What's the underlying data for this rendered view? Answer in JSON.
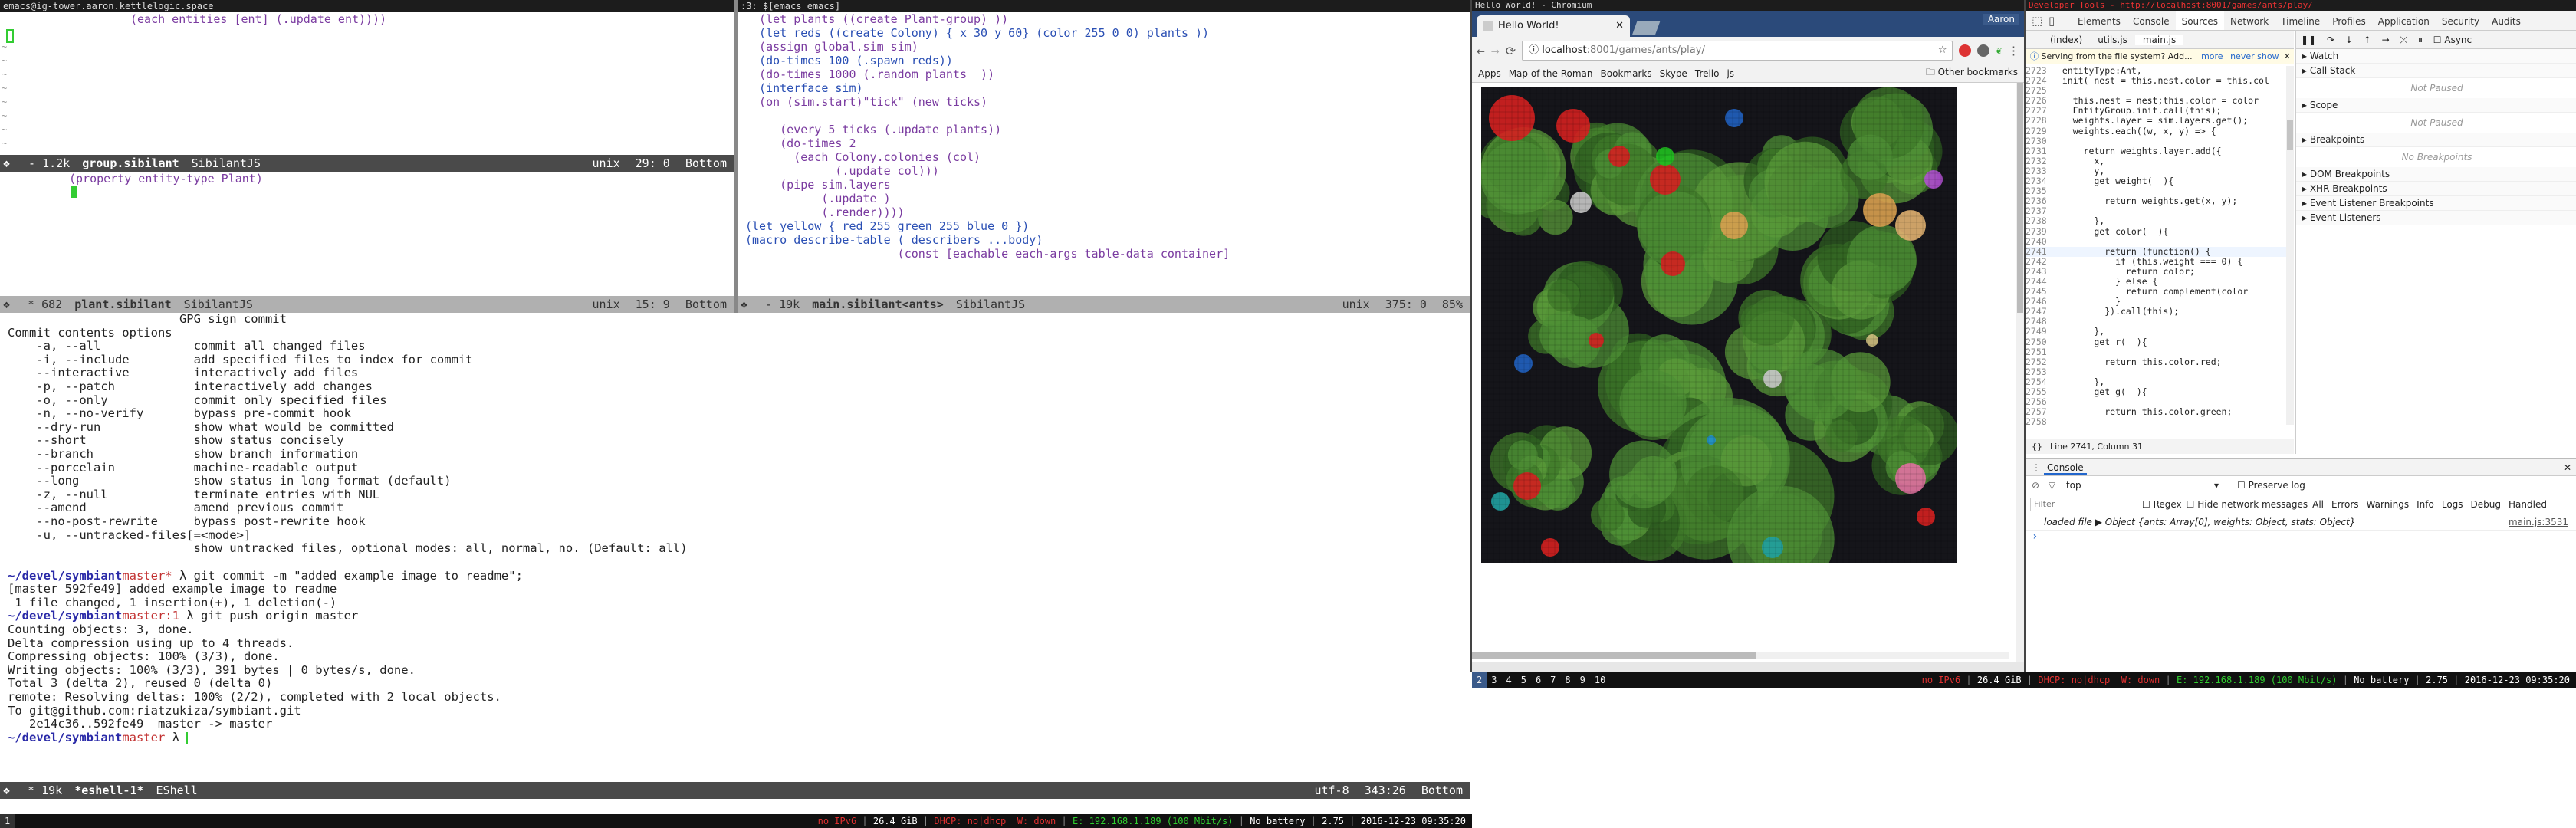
{
  "emacs": {
    "title": "emacs@ig-tower.aaron.kettlelogic.space",
    "top_pane_line": "(each entities [ent] (.update ent))))",
    "modeline1": {
      "status": " - 1.2k",
      "buffer": "group.sibilant",
      "mode": "SibilantJS",
      "enc": "unix",
      "pos": "29: 0",
      "scroll": "Bottom"
    },
    "middle_pane": [
      "(property entity-type Plant)"
    ],
    "modeline2": {
      "status": " * 682",
      "buffer": "plant.sibilant",
      "mode": "SibilantJS",
      "enc": "unix",
      "pos": "15: 9",
      "scroll": "Bottom"
    },
    "commit_help": [
      "                        GPG sign commit",
      "",
      "Commit contents options",
      "    -a, --all             commit all changed files",
      "    -i, --include         add specified files to index for commit",
      "    --interactive         interactively add files",
      "    -p, --patch           interactively add changes",
      "    -o, --only            commit only specified files",
      "    -n, --no-verify       bypass pre-commit hook",
      "    --dry-run             show what would be committed",
      "    --short               show status concisely",
      "    --branch              show branch information",
      "    --porcelain           machine-readable output",
      "    --long                show status in long format (default)",
      "    -z, --null            terminate entries with NUL",
      "    --amend               amend previous commit",
      "    --no-post-rewrite     bypass post-rewrite hook",
      "    -u, --untracked-files[=<mode>]",
      "                          show untracked files, optional modes: all, normal, no. (Default: all)"
    ],
    "prompt_path": "~/devel/symbiant",
    "prompt_branch": "master*",
    "prompt_branch2": "master:1",
    "prompt_branch3": "master",
    "cmd1": " λ git commit -m \"added example image to readme\";",
    "cmd2": " λ git push origin master",
    "output1": [
      "[master 592fe49] added example image to readme",
      " 1 file changed, 1 insertion(+), 1 deletion(-)"
    ],
    "output2": [
      "Counting objects: 3, done.",
      "Delta compression using up to 4 threads.",
      "Compressing objects: 100% (3/3), done.",
      "Writing objects: 100% (3/3), 391 bytes | 0 bytes/s, done.",
      "Total 3 (delta 2), reused 0 (delta 0)",
      "remote: Resolving deltas: 100% (2/2), completed with 2 local objects.",
      "To git@github.com:riatzukiza/symbiant.git",
      "   2e14c36..592fe49  master -> master"
    ],
    "cmd3": " λ ",
    "modeline3": {
      "status": " * 19k",
      "buffer": "*eshell-1*",
      "mode": "EShell",
      "enc": "utf-8",
      "pos": "343:26",
      "scroll": "Bottom"
    },
    "right_title": ":3: $[emacs emacs]",
    "right_modeline": {
      "status": " - 19k",
      "buffer": "main.sibilant<ants>",
      "mode": "SibilantJS",
      "enc": "unix",
      "pos": "375: 0",
      "scroll": "85%"
    }
  },
  "code": {
    "lines": [
      [
        "  ",
        "(let plants ((create Plant-group) ))"
      ],
      [
        "  ",
        "(let reds ((create Colony) { x 30 y 60} (color 255 0 0) plants ))"
      ],
      [
        "  ",
        "(assign global.sim sim)"
      ],
      [
        "  ",
        "(do-times 100 (.spawn reds))"
      ],
      [
        "  ",
        "(do-times 1000 (.random plants  ))"
      ],
      [
        "  ",
        "(interface sim)"
      ],
      [
        "  ",
        "(on (sim.start)\"tick\" (new ticks)"
      ],
      [
        "  ",
        ""
      ],
      [
        "  ",
        "   (every 5 ticks (.update plants))"
      ],
      [
        "  ",
        "   (do-times 2"
      ],
      [
        "  ",
        "     (each Colony.colonies (col)"
      ],
      [
        "  ",
        "           (.update col)))"
      ],
      [
        "  ",
        "   (pipe sim.layers"
      ],
      [
        "  ",
        "         (.update )"
      ],
      [
        "  ",
        "         (.render))))"
      ],
      [
        "",
        "(let yellow { red 255 green 255 blue 0 })"
      ],
      [
        "",
        ""
      ],
      [
        "",
        ""
      ],
      [
        "",
        "(macro describe-table ( describers ...body)"
      ],
      [
        "",
        "                      (const [eachable each-args table-data container]"
      ]
    ]
  },
  "chromium": {
    "window_title": "Hello World! - Chromium",
    "user": "Aaron",
    "tab_title": "Hello World!",
    "url_host": "localhost",
    "url_rest": ":8001/games/ants/play/",
    "bookmarks": [
      "Apps",
      "Map of the Roman",
      "Bookmarks",
      "Skype",
      "Trello",
      "js"
    ],
    "other_bookmarks": "Other bookmarks"
  },
  "devtools": {
    "title": "Developer Tools - http://localhost:8001/games/ants/play/",
    "tabs": [
      "Elements",
      "Console",
      "Sources",
      "Network",
      "Timeline",
      "Profiles",
      "Application",
      "Security",
      "Audits"
    ],
    "active_tab": "Sources",
    "file_tabs": [
      "(index)",
      "utils.js",
      "main.js"
    ],
    "notice": "Serving from the file system? Add...",
    "notice_more": "more",
    "notice_never": "never show",
    "code_start": 2723,
    "code": [
      "  entityType:Ant,",
      "  init( nest = this.nest.color = this.col",
      "",
      "    this.nest = nest;this.color = color",
      "    EntityGroup.init.call(this);",
      "    weights.layer = sim.layers.get();",
      "    weights.each((w, x, y) => {",
      "",
      "      return weights.layer.add({",
      "        x,",
      "        y,",
      "        get weight(  ){",
      "",
      "          return weights.get(x, y);",
      "",
      "        },",
      "        get color(  ){",
      "",
      "          return (function() {",
      "            if (this.weight === 0) {",
      "              return color;",
      "            } else {",
      "              return complement(color",
      "            }",
      "          }).call(this);",
      "",
      "        },",
      "        get r(  ){",
      "",
      "          return this.color.red;",
      "",
      "        },",
      "        get g(  ){",
      "",
      "          return this.color.green;",
      ""
    ],
    "cursor": "Line 2741, Column 31",
    "async": "Async",
    "sidebar": [
      {
        "head": "Watch",
        "info": ""
      },
      {
        "head": "Call Stack",
        "info": "Not Paused"
      },
      {
        "head": "Scope",
        "info": "Not Paused"
      },
      {
        "head": "Breakpoints",
        "info": "No Breakpoints"
      },
      {
        "head": "DOM Breakpoints",
        "info": ""
      },
      {
        "head": "XHR Breakpoints",
        "info": ""
      },
      {
        "head": "Event Listener Breakpoints",
        "info": ""
      },
      {
        "head": "Event Listeners",
        "info": ""
      }
    ],
    "console_label": "Console",
    "context": "top",
    "preserve_log": "Preserve log",
    "filter_placeholder": "Filter",
    "regex": "Regex",
    "hide_network": "Hide network messages",
    "levels": [
      "All",
      "Errors",
      "Warnings",
      "Info",
      "Logs",
      "Debug",
      "Handled"
    ],
    "log_text": "loaded file ▶ Object {ants: Array[0], weights: Object, stats: Object}",
    "log_source": "main.js:3531"
  },
  "status": {
    "left_workspaces": "1",
    "right_workspaces": [
      "2",
      "3",
      "4",
      "5",
      "6",
      "7",
      "8",
      "9",
      "10"
    ],
    "line": "no IPv6 | 26.4 GiB | DHCP: no | dhcp | wifi down | E: 192.168.1.189 (100 Mbit/s) | No battery | 2.75 | 2016-12-23 09:35:20",
    "segments": [
      {
        "text": "no IPv6",
        "color": "#e03030"
      },
      {
        "text": "26.4 GiB",
        "color": "#ffffff"
      },
      {
        "text": "DHCP: no|dhcp  W: down",
        "color": "#e03030"
      },
      {
        "text": "E: 192.168.1.189 (100 Mbit/s)",
        "color": "#30d030"
      },
      {
        "text": "No battery",
        "color": "#ffffff"
      },
      {
        "text": "2.75",
        "color": "#ffffff"
      },
      {
        "text": "2016-12-23 09:35:20",
        "color": "#ffffff"
      }
    ]
  }
}
